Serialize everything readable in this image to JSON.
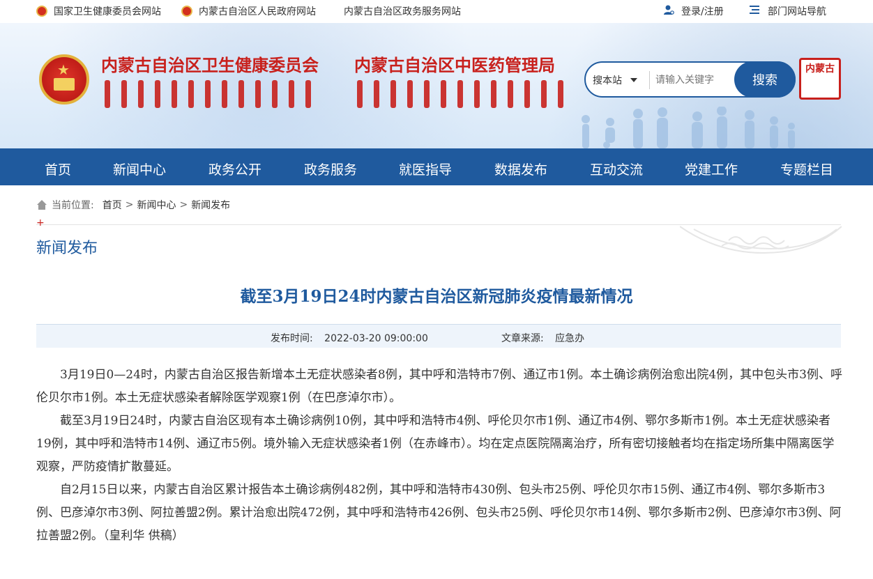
{
  "topbar": {
    "left_links": [
      "国家卫生健康委员会网站",
      "内蒙古自治区人民政府网站",
      "内蒙古自治区政务服务网站"
    ],
    "login": "登录/注册",
    "dept_nav": "部门网站导航"
  },
  "header": {
    "org_name_1": "内蒙古自治区卫生健康委员会",
    "org_name_2": "内蒙古自治区中医药管理局",
    "search_scope": "搜本站",
    "search_placeholder": "请输入关键字",
    "search_button": "搜索",
    "seal_text": "内蒙古"
  },
  "nav": {
    "items": [
      "首页",
      "新闻中心",
      "政务公开",
      "政务服务",
      "就医指导",
      "数据发布",
      "互动交流",
      "党建工作",
      "专题栏目"
    ]
  },
  "breadcrumb": {
    "label": "当前位置:",
    "items": [
      "首页",
      "新闻中心",
      "新闻发布"
    ],
    "sep": ">"
  },
  "section": {
    "plus": "+",
    "title": "新闻发布"
  },
  "article": {
    "title": "截至3月19日24时内蒙古自治区新冠肺炎疫情最新情况",
    "publish_label": "发布时间:",
    "publish_time": "2022-03-20 09:00:00",
    "source_label": "文章来源:",
    "source": "应急办",
    "paragraphs": [
      "3月19日0—24时，内蒙古自治区报告新增本土无症状感染者8例，其中呼和浩特市7例、通辽市1例。本土确诊病例治愈出院4例，其中包头市3例、呼伦贝尔市1例。本土无症状感染者解除医学观察1例（在巴彦淖尔市）。",
      "截至3月19日24时，内蒙古自治区现有本土确诊病例10例，其中呼和浩特市4例、呼伦贝尔市1例、通辽市4例、鄂尔多斯市1例。本土无症状感染者19例，其中呼和浩特市14例、通辽市5例。境外输入无症状感染者1例（在赤峰市）。均在定点医院隔离治疗，所有密切接触者均在指定场所集中隔离医学观察，严防疫情扩散蔓延。",
      "自2月15日以来，内蒙古自治区累计报告本土确诊病例482例，其中呼和浩特市430例、包头市25例、呼伦贝尔市15例、通辽市4例、鄂尔多斯市3例、巴彦淖尔市3例、阿拉善盟2例。累计治愈出院472例，其中呼和浩特市426例、包头市25例、呼伦贝尔市14例、鄂尔多斯市2例、巴彦淖尔市3例、阿拉善盟2例。（皇利华 供稿）"
    ]
  },
  "colors": {
    "brand_blue": "#1f5a9e",
    "brand_red": "#c8201c",
    "meta_bg": "#eef4fb"
  },
  "icons": [
    "national-emblem-icon",
    "user-icon",
    "menu-list-icon",
    "home-icon",
    "chevron-down-icon"
  ]
}
